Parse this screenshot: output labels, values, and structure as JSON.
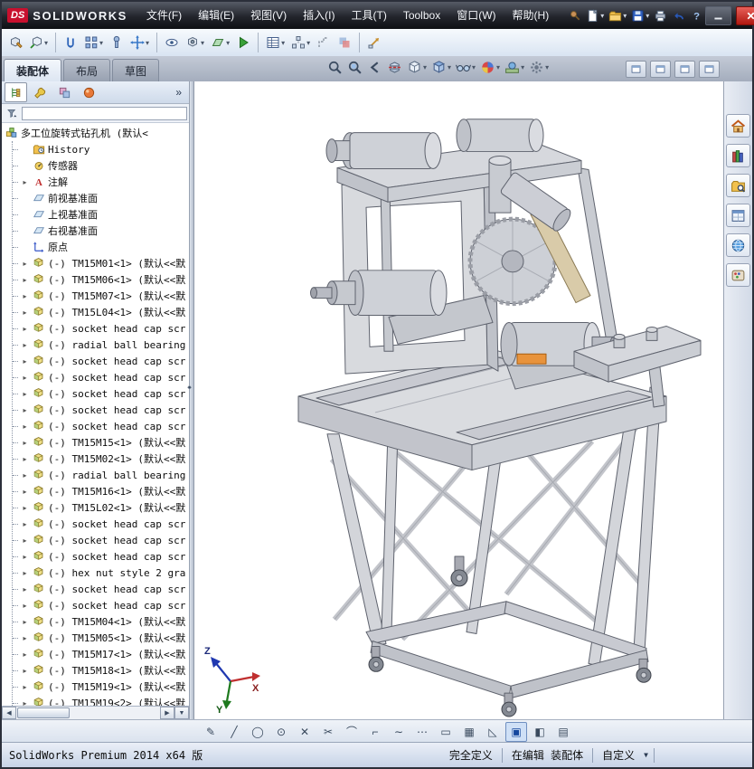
{
  "ui": {
    "dropdown": "▾",
    "expander": "▸",
    "scroll_left": "◀",
    "scroll_right": "▶",
    "scroll_down": "▼",
    "splitter": "◂▸"
  },
  "titlebar": {
    "logo_ds": "DS",
    "logo_text": "SOLIDWORKS",
    "menus": [
      {
        "name": "menu-file",
        "label": "文件(F)"
      },
      {
        "name": "menu-edit",
        "label": "编辑(E)"
      },
      {
        "name": "menu-view",
        "label": "视图(V)"
      },
      {
        "name": "menu-insert",
        "label": "插入(I)"
      },
      {
        "name": "menu-tools",
        "label": "工具(T)"
      },
      {
        "name": "menu-toolbox",
        "label": "Toolbox"
      },
      {
        "name": "menu-window",
        "label": "窗口(W)"
      },
      {
        "name": "menu-help",
        "label": "帮助(H)"
      }
    ],
    "quick_icons": [
      {
        "name": "pin",
        "kind": "pin"
      },
      {
        "name": "new-document",
        "kind": "page",
        "dropdown": true
      },
      {
        "name": "open-document",
        "kind": "folder",
        "dropdown": true
      },
      {
        "name": "save",
        "kind": "floppy",
        "dropdown": true
      },
      {
        "name": "print",
        "kind": "printer"
      },
      {
        "name": "undo",
        "kind": "undo"
      },
      {
        "name": "help",
        "kind": "help"
      }
    ],
    "window_buttons": [
      {
        "name": "minimize-window",
        "kind": "minimize"
      },
      {
        "name": "close-window",
        "kind": "close"
      }
    ]
  },
  "toolbar": {
    "icons": [
      {
        "name": "edit-component",
        "kind": "editcomp"
      },
      {
        "name": "insert-components",
        "kind": "insertcomp",
        "dropdown": true,
        "sep_after": true
      },
      {
        "name": "mate",
        "kind": "mate"
      },
      {
        "name": "linear-component-pattern",
        "kind": "pattern",
        "dropdown": true
      },
      {
        "name": "smart-fasteners",
        "kind": "fastener"
      },
      {
        "name": "move-component",
        "kind": "movecomp",
        "dropdown": true,
        "sep_after": true
      },
      {
        "name": "show-hidden-components",
        "kind": "showhide"
      },
      {
        "name": "assembly-features",
        "kind": "asmfeat",
        "dropdown": true
      },
      {
        "name": "reference-geometry",
        "kind": "refgeo",
        "dropdown": true
      },
      {
        "name": "new-motion-study",
        "kind": "motion",
        "sep_after": true
      },
      {
        "name": "bill-of-materials",
        "kind": "bom",
        "dropdown": true
      },
      {
        "name": "exploded-view",
        "kind": "explode",
        "dropdown": true
      },
      {
        "name": "explode-line-sketch",
        "kind": "explline"
      },
      {
        "name": "interference-detection",
        "kind": "interfere",
        "sep_after": true
      },
      {
        "name": "instant3d",
        "kind": "instant3d"
      }
    ]
  },
  "tabs": [
    {
      "name": "assembly",
      "label": "装配体",
      "active": true
    },
    {
      "name": "layout",
      "label": "布局",
      "active": false
    },
    {
      "name": "sketch",
      "label": "草图",
      "active": false
    }
  ],
  "headsup": [
    {
      "name": "zoom-to-fit",
      "kind": "magnifier"
    },
    {
      "name": "zoom-to-area",
      "kind": "magarea"
    },
    {
      "name": "previous-view",
      "kind": "prevview"
    },
    {
      "name": "section-view",
      "kind": "section"
    },
    {
      "name": "view-orientation",
      "kind": "vieworient",
      "dropdown": true
    },
    {
      "name": "display-style",
      "kind": "dispstyle",
      "dropdown": true
    },
    {
      "name": "hide-show-items",
      "kind": "glasses",
      "dropdown": true
    },
    {
      "name": "edit-appearance",
      "kind": "appearance",
      "dropdown": true
    },
    {
      "name": "apply-scene",
      "kind": "scene",
      "dropdown": true
    },
    {
      "name": "view-settings",
      "kind": "settings",
      "dropdown": true
    }
  ],
  "doc_windows": [
    {
      "name": "doc-new-window",
      "kind": "docwin"
    },
    {
      "name": "doc-minimize",
      "kind": "docwin"
    },
    {
      "name": "doc-restore",
      "kind": "docwin"
    },
    {
      "name": "doc-close",
      "kind": "docwin"
    }
  ],
  "panel": {
    "overflow_label": "»",
    "header_icons": [
      {
        "name": "featuremanager-tab",
        "kind": "treetab",
        "active": true
      },
      {
        "name": "propertymanager-tab",
        "kind": "proptab"
      },
      {
        "name": "configurationmanager-tab",
        "kind": "cfgtab"
      },
      {
        "name": "dimxpertmanager-tab",
        "kind": "disptab"
      }
    ],
    "tree": {
      "root": {
        "icon": "assembly",
        "label": "多工位旋转式钻孔机 (默认<"
      },
      "items": [
        {
          "icon": "history",
          "label": "History"
        },
        {
          "icon": "sensors",
          "label": "传感器"
        },
        {
          "icon": "ann",
          "label": "注解",
          "expander": true
        },
        {
          "icon": "plane",
          "label": "前视基准面"
        },
        {
          "icon": "plane",
          "label": "上视基准面"
        },
        {
          "icon": "plane",
          "label": "右视基准面"
        },
        {
          "icon": "origin",
          "label": "原点"
        },
        {
          "icon": "component",
          "label": "(-) TM15M01<1> (默认<<默",
          "expander": true
        },
        {
          "icon": "component",
          "label": "(-) TM15M06<1> (默认<<默",
          "expander": true
        },
        {
          "icon": "component",
          "label": "(-) TM15M07<1> (默认<<默",
          "expander": true
        },
        {
          "icon": "component",
          "label": "(-) TM15L04<1> (默认<<默",
          "expander": true
        },
        {
          "icon": "component",
          "label": "(-) socket head cap scr",
          "expander": true
        },
        {
          "icon": "component",
          "label": "(-) radial ball bearing",
          "expander": true
        },
        {
          "icon": "component",
          "label": "(-) socket head cap scr",
          "expander": true
        },
        {
          "icon": "component",
          "label": "(-) socket head cap scr",
          "expander": true
        },
        {
          "icon": "component",
          "label": "(-) socket head cap scr",
          "expander": true
        },
        {
          "icon": "component",
          "label": "(-) socket head cap scr",
          "expander": true
        },
        {
          "icon": "component",
          "label": "(-) socket head cap scr",
          "expander": true
        },
        {
          "icon": "component",
          "label": "(-) TM15M15<1> (默认<<默",
          "expander": true
        },
        {
          "icon": "component",
          "label": "(-) TM15M02<1> (默认<<默",
          "expander": true
        },
        {
          "icon": "component",
          "label": "(-) radial ball bearing",
          "expander": true
        },
        {
          "icon": "component",
          "label": "(-) TM15M16<1> (默认<<默",
          "expander": true
        },
        {
          "icon": "component",
          "label": "(-) TM15L02<1> (默认<<默",
          "expander": true
        },
        {
          "icon": "component",
          "label": "(-) socket head cap scr",
          "expander": true
        },
        {
          "icon": "component",
          "label": "(-) socket head cap scr",
          "expander": true
        },
        {
          "icon": "component",
          "label": "(-) socket head cap scr",
          "expander": true
        },
        {
          "icon": "component",
          "label": "(-) hex nut style 2 gra",
          "expander": true
        },
        {
          "icon": "component",
          "label": "(-) socket head cap scr",
          "expander": true
        },
        {
          "icon": "component",
          "label": "(-) socket head cap scr",
          "expander": true
        },
        {
          "icon": "component",
          "label": "(-) TM15M04<1> (默认<<默",
          "expander": true
        },
        {
          "icon": "component",
          "label": "(-) TM15M05<1> (默认<<默",
          "expander": true
        },
        {
          "icon": "component",
          "label": "(-) TM15M17<1> (默认<<默",
          "expander": true
        },
        {
          "icon": "component",
          "label": "(-) TM15M18<1> (默认<<默",
          "expander": true
        },
        {
          "icon": "component",
          "label": "(-) TM15M19<1> (默认<<默",
          "expander": true
        },
        {
          "icon": "component",
          "label": "(-) TM15M19<2> (默认<<默",
          "expander": true
        }
      ]
    }
  },
  "taskpane": [
    {
      "name": "solidworks-resources",
      "kind": "house"
    },
    {
      "name": "design-library",
      "kind": "books"
    },
    {
      "name": "file-explorer",
      "kind": "foldersearch"
    },
    {
      "name": "view-palette",
      "kind": "pane"
    },
    {
      "name": "appearances-scenes",
      "kind": "globe"
    },
    {
      "name": "custom-properties",
      "kind": "palette"
    }
  ],
  "bottom_toolbar": [
    {
      "name": "sketch",
      "glyph": "✎"
    },
    {
      "name": "line",
      "glyph": "╱"
    },
    {
      "name": "circle",
      "glyph": "◯"
    },
    {
      "name": "ellipse",
      "glyph": "⊙"
    },
    {
      "name": "erase",
      "glyph": "✕"
    },
    {
      "name": "trim",
      "glyph": "✂"
    },
    {
      "name": "arc",
      "glyph": "⌒"
    },
    {
      "name": "centerline",
      "glyph": "⌐"
    },
    {
      "name": "spline",
      "glyph": "∼"
    },
    {
      "name": "point",
      "glyph": "⋯"
    },
    {
      "name": "rectangle",
      "glyph": "▭"
    },
    {
      "name": "linear-pattern",
      "glyph": "▦"
    },
    {
      "name": "polygon",
      "glyph": "◺"
    },
    {
      "name": "shaded-contours",
      "glyph": "▣",
      "active": true
    },
    {
      "name": "split-pane",
      "glyph": "◧"
    },
    {
      "name": "grid",
      "glyph": "▤"
    }
  ],
  "viewport": {
    "triad": {
      "x": "X",
      "y": "Y",
      "z": "Z"
    }
  },
  "statusbar": {
    "app": "SolidWorks Premium 2014 x64 版",
    "fully_defined": "完全定义",
    "editing": "在编辑 装配体",
    "custom": "自定义"
  }
}
